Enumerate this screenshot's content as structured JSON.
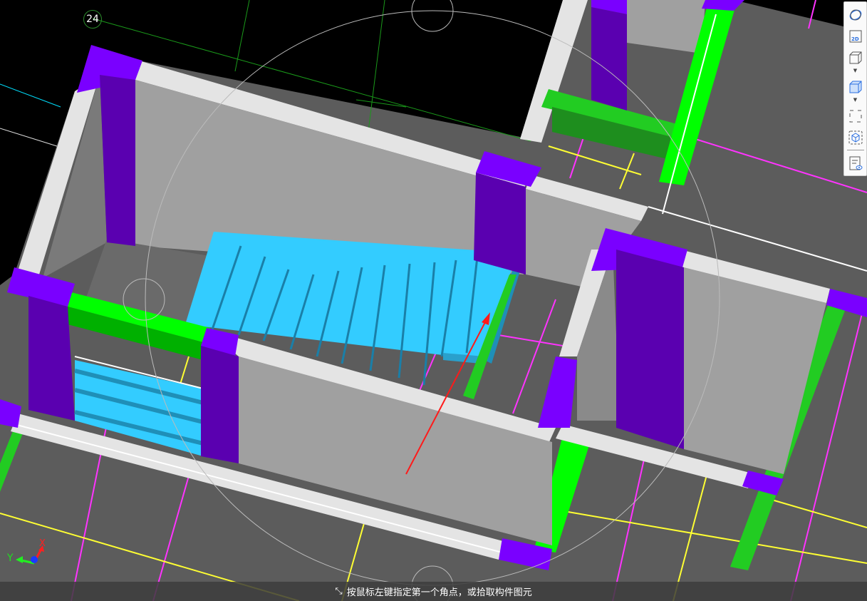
{
  "viewport": {
    "grid_label": "24",
    "axis": {
      "x": "X",
      "y": "Y"
    }
  },
  "toolbar": {
    "buttons": [
      "dynamic-observe",
      "2D",
      "3D-view",
      "3D-solid",
      "region-select",
      "component-view",
      "display-settings"
    ]
  },
  "status_bar": {
    "message": "按鼠标左键指定第一个角点，或拾取构件图元"
  },
  "colors": {
    "column_top": "#7a00ff",
    "column_face": "#5a00b0",
    "wall_face": "#a0a0a0",
    "wall_top": "#e4e4e4",
    "stair": "#33ccff",
    "beam": "#00ff00",
    "floor": "#5c5c5c"
  }
}
